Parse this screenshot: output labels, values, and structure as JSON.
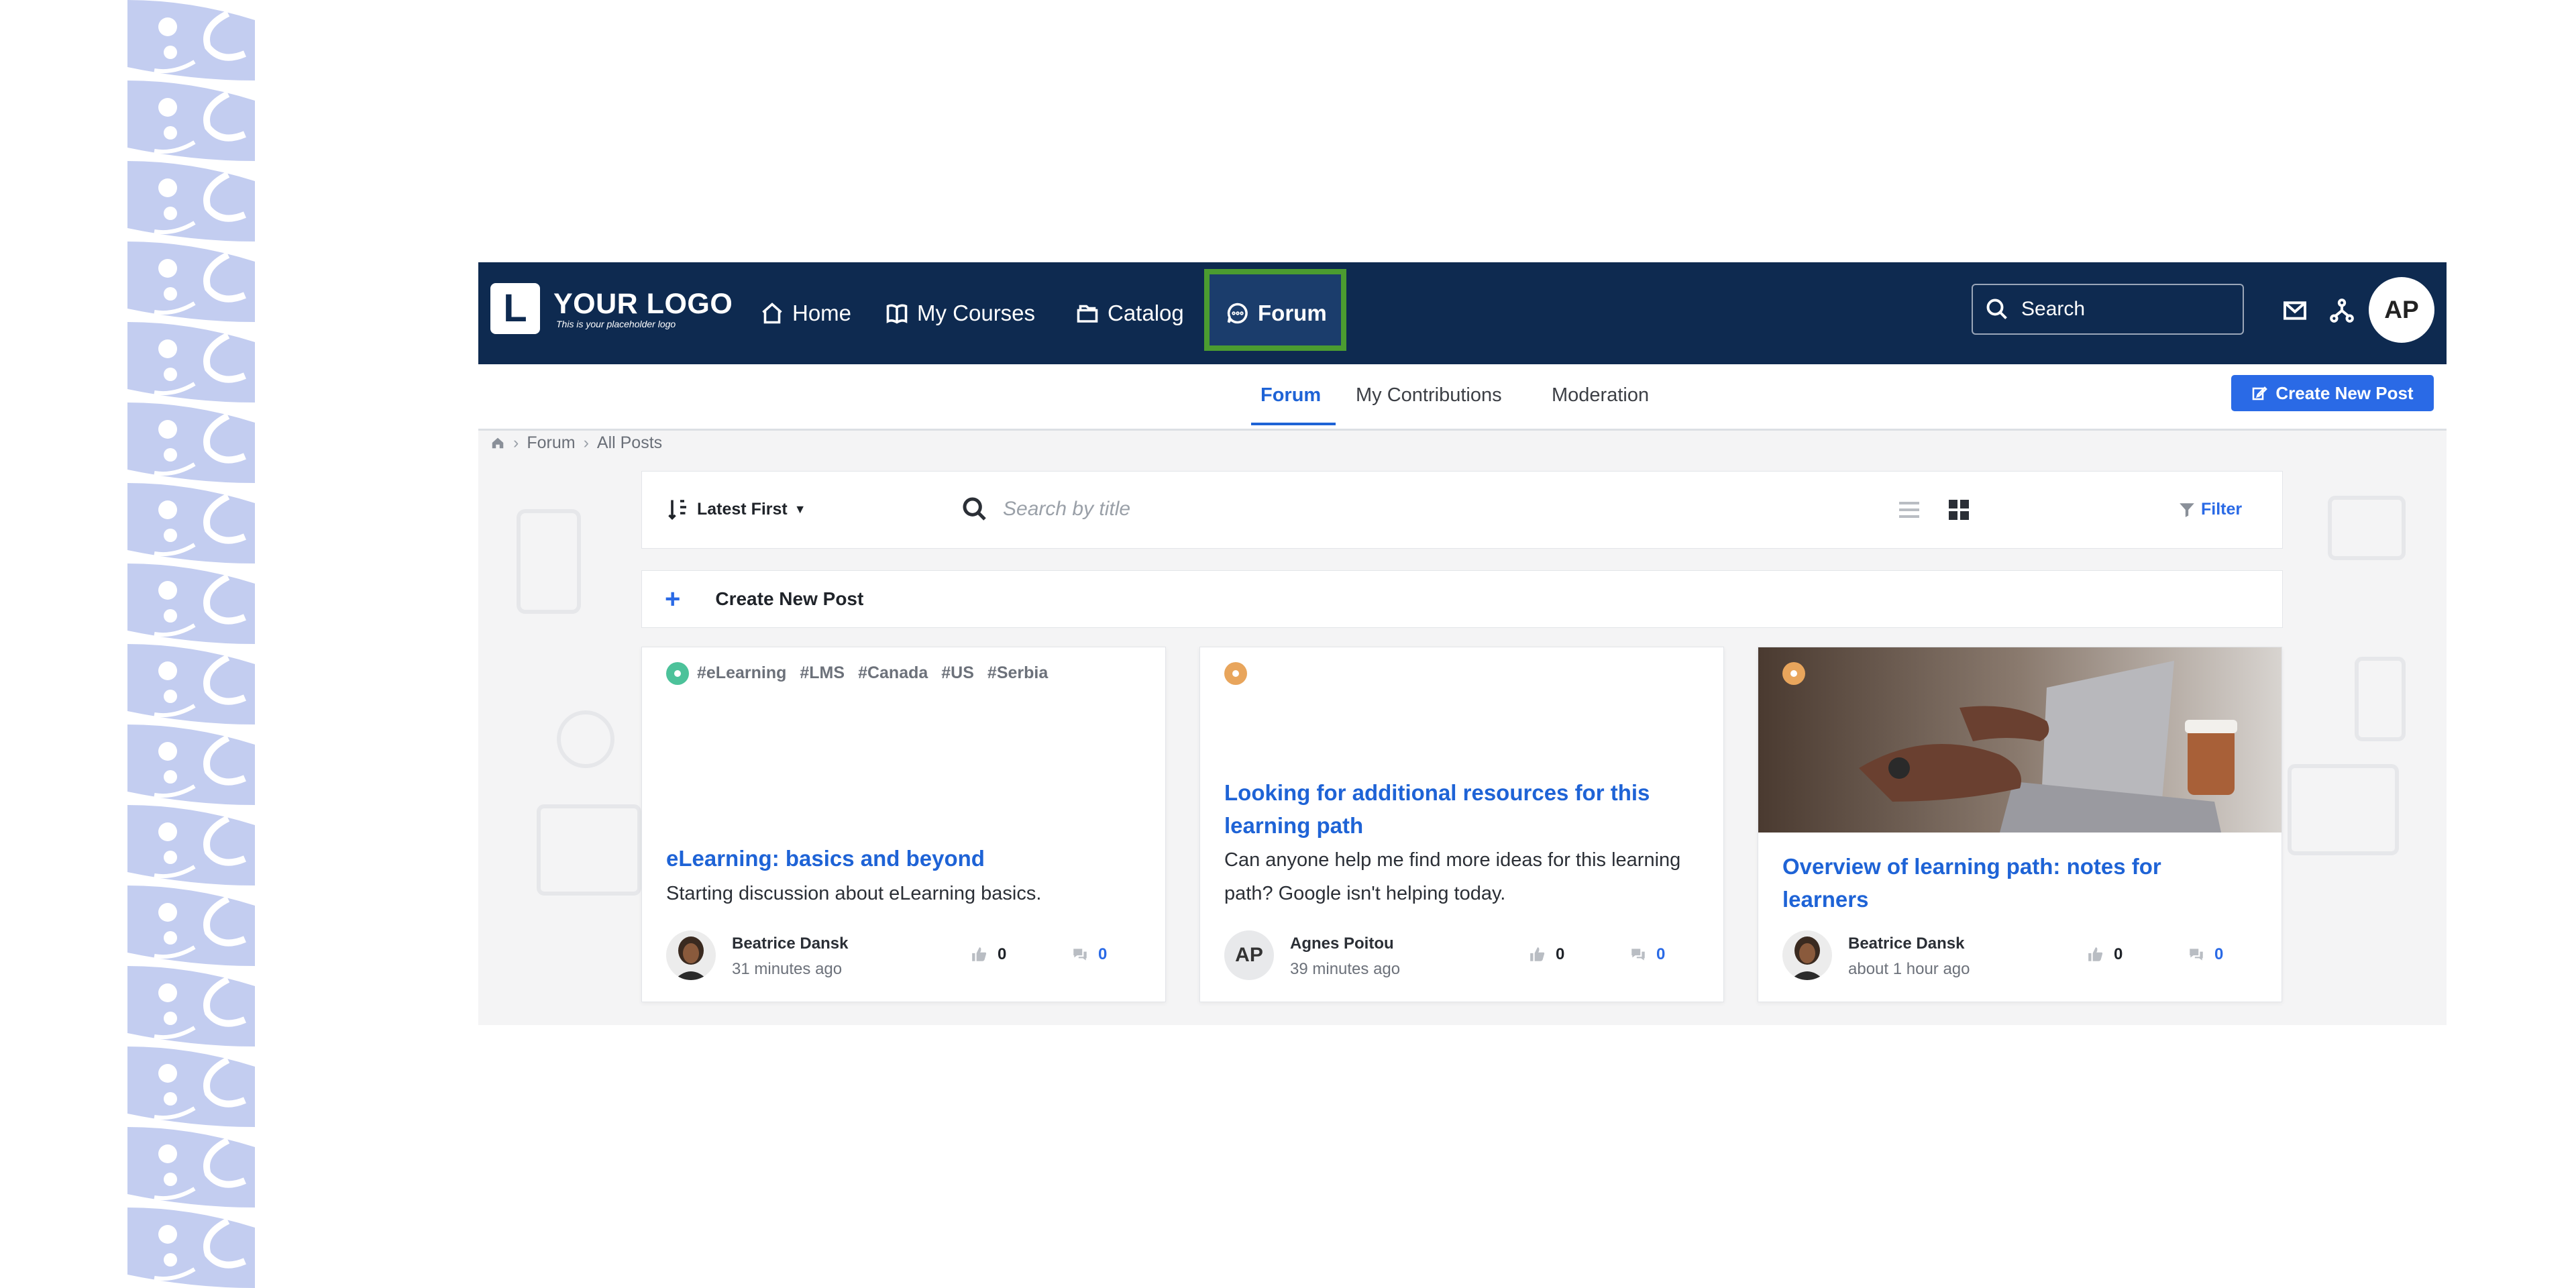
{
  "header": {
    "logo_letter": "L",
    "logo_title": "YOUR LOGO",
    "logo_subtitle": "This is your placeholder logo",
    "nav": [
      {
        "label": "Home",
        "icon": "home-icon"
      },
      {
        "label": "My Courses",
        "icon": "book-icon"
      },
      {
        "label": "Catalog",
        "icon": "catalog-icon"
      },
      {
        "label": "Forum",
        "icon": "chat-icon",
        "active": true
      }
    ],
    "search_label": "Search",
    "user_initials": "AP",
    "colors": {
      "bar": "#0e2a50",
      "highlight_border": "#4b9c30"
    }
  },
  "subnav": {
    "tabs": [
      "Forum",
      "My Contributions",
      "Moderation"
    ],
    "active_tab": "Forum",
    "create_button": "Create New Post",
    "accent": "#2a6ae6"
  },
  "breadcrumb": [
    "Forum",
    "All Posts"
  ],
  "toolbar": {
    "sort_label": "Latest First",
    "search_placeholder": "Search by title",
    "view_mode": "grid",
    "filter_label": "Filter"
  },
  "create_bar": {
    "plus": "+",
    "label": "Create New Post"
  },
  "posts": [
    {
      "category_color": "#4cc29a",
      "tags": [
        "#eLearning",
        "#LMS",
        "#Canada",
        "#US",
        "#Serbia"
      ],
      "title": "eLearning: basics and beyond",
      "description": "Starting discussion about eLearning basics.",
      "author": "Beatrice Dansk",
      "time": "31 minutes ago",
      "likes": "0",
      "comments": "0"
    },
    {
      "category_color": "#e8a55c",
      "tags": [],
      "title": "Looking for additional resources for this learning path",
      "description": "Can anyone help me find more ideas for this learning path? Google isn't helping today.",
      "author": "Agnes Poitou",
      "author_initials": "AP",
      "time": "39 minutes ago",
      "likes": "0",
      "comments": "0"
    },
    {
      "category_color": "#e8a55c",
      "tags": [],
      "title": "Overview of learning path: notes for learners",
      "description": "",
      "author": "Beatrice Dansk",
      "time": "about 1 hour ago",
      "likes": "0",
      "comments": "0"
    }
  ]
}
